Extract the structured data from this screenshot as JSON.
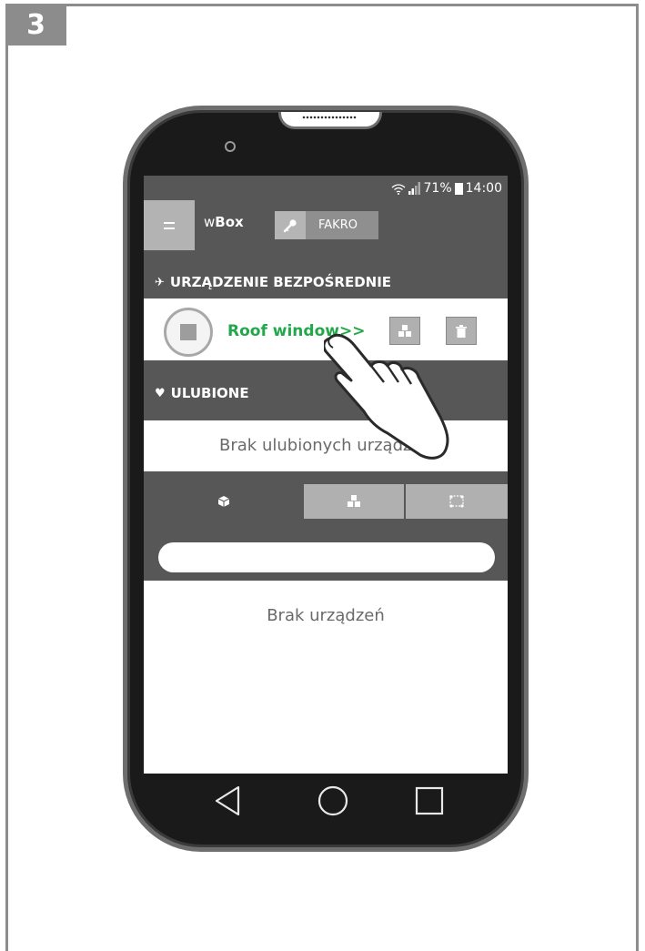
{
  "step_number": "3",
  "status_bar": {
    "battery": "71%",
    "time": "14:00"
  },
  "header": {
    "app_prefix": "w",
    "app_bold": "Box",
    "account_label": "FAKRO"
  },
  "direct_section": {
    "title": "URZĄDZENIE BEZPOŚREDNIE",
    "device_name": "Roof window>>"
  },
  "favorites_section": {
    "title": "ULUBIONE",
    "empty_text": "Brak ulubionych urządzeń"
  },
  "devices_section": {
    "tabs": [
      {
        "icon": "cube-icon"
      },
      {
        "icon": "cubes-group-icon"
      },
      {
        "icon": "scene-icon"
      }
    ],
    "search": {
      "value": "",
      "placeholder": ""
    },
    "empty_text": "Brak urządzeń"
  },
  "colors": {
    "bar": "#575757",
    "device_name": "#22a84a",
    "frame": "#8c8c8c"
  }
}
